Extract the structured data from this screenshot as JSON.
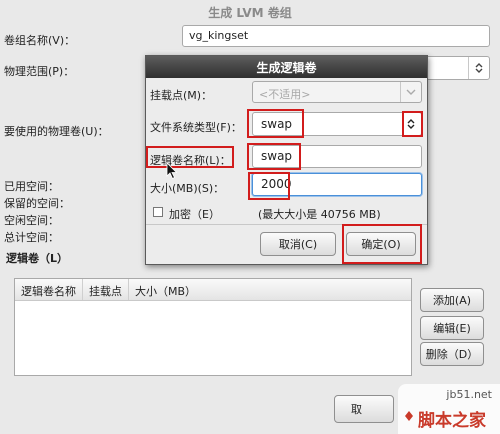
{
  "main_window": {
    "title": "生成 LVM 卷组",
    "vg_name_label": "卷组名称(V)：",
    "vg_name_value": "vg_kingset",
    "pe_label": "物理范围(P)：",
    "pv_label": "要使用的物理卷(U)：",
    "used_label": "已用空间：",
    "reserved_label": "保留的空间：",
    "free_label": "空闲空间：",
    "total_label": "总计空间：",
    "lv_section_label": "逻辑卷（L）",
    "lv_table_headers": [
      "逻辑卷名称",
      "挂载点",
      "大小（MB）"
    ],
    "add_button": "添加(A)",
    "edit_button": "编辑(E)",
    "delete_button": "删除（D）",
    "bottom_button_partial": "取"
  },
  "dialog": {
    "title": "生成逻辑卷",
    "mount_label": "挂载点(M)：",
    "mount_placeholder": "<不适用>",
    "fs_label": "文件系统类型(F)：",
    "fs_value": "swap",
    "lv_name_label": "逻辑卷名称(L)：",
    "lv_name_value": "swap",
    "size_label": "大小(MB)(S)：",
    "size_value": "2000",
    "encrypt_label": "加密（E）",
    "max_size_text": "(最大大小是 40756 MB)",
    "cancel_button": "取消(C)",
    "ok_button": "确定(O)"
  },
  "watermark": {
    "site": "jb51.net",
    "brand": "脚本之家"
  },
  "colors": {
    "highlight_red": "#d21c1c",
    "focus_blue": "#4a90d9"
  }
}
